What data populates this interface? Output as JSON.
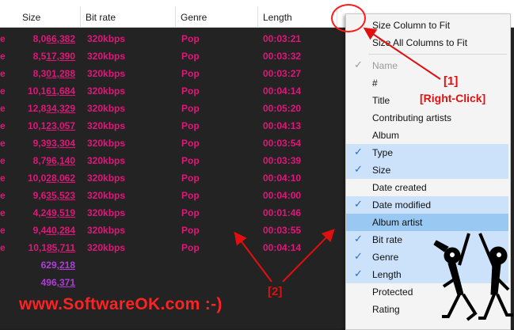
{
  "header": {
    "columns": [
      {
        "label": "Size"
      },
      {
        "label": "Bit rate"
      },
      {
        "label": "Genre"
      },
      {
        "label": "Length"
      }
    ]
  },
  "rows": [
    {
      "prefix": "e",
      "size_a": "8,0",
      "size_b": "66,382",
      "bitrate": "320kbps",
      "genre": "Pop",
      "length": "00:03:21"
    },
    {
      "prefix": "e",
      "size_a": "8,5",
      "size_b": "17,390",
      "bitrate": "320kbps",
      "genre": "Pop",
      "length": "00:03:32"
    },
    {
      "prefix": "e",
      "size_a": "8,3",
      "size_b": "01,288",
      "bitrate": "320kbps",
      "genre": "Pop",
      "length": "00:03:27"
    },
    {
      "prefix": "e",
      "size_a": "10,1",
      "size_b": "61,684",
      "bitrate": "320kbps",
      "genre": "Pop",
      "length": "00:04:14"
    },
    {
      "prefix": "e",
      "size_a": "12,8",
      "size_b": "34,329",
      "bitrate": "320kbps",
      "genre": "Pop",
      "length": "00:05:20"
    },
    {
      "prefix": "e",
      "size_a": "10,1",
      "size_b": "23,057",
      "bitrate": "320kbps",
      "genre": "Pop",
      "length": "00:04:13"
    },
    {
      "prefix": "e",
      "size_a": "9,3",
      "size_b": "93,304",
      "bitrate": "320kbps",
      "genre": "Pop",
      "length": "00:03:54"
    },
    {
      "prefix": "e",
      "size_a": "8,7",
      "size_b": "96,140",
      "bitrate": "320kbps",
      "genre": "Pop",
      "length": "00:03:39"
    },
    {
      "prefix": "e",
      "size_a": "10,0",
      "size_b": "28,062",
      "bitrate": "320kbps",
      "genre": "Pop",
      "length": "00:04:10"
    },
    {
      "prefix": "e",
      "size_a": "9,6",
      "size_b": "35,523",
      "bitrate": "320kbps",
      "genre": "Pop",
      "length": "00:04:00"
    },
    {
      "prefix": "e",
      "size_a": "4,2",
      "size_b": "49,519",
      "bitrate": "320kbps",
      "genre": "Pop",
      "length": "00:01:46"
    },
    {
      "prefix": "e",
      "size_a": "9,4",
      "size_b": "40,284",
      "bitrate": "320kbps",
      "genre": "Pop",
      "length": "00:03:55"
    },
    {
      "prefix": "e",
      "size_a": "10,1",
      "size_b": "85,711",
      "bitrate": "320kbps",
      "genre": "Pop",
      "length": "00:04:14"
    },
    {
      "prefix": "",
      "size_a": "629,",
      "size_b": "218",
      "bitrate": "",
      "genre": "",
      "length": "",
      "purple": true
    },
    {
      "prefix": "",
      "size_a": "496,",
      "size_b": "371",
      "bitrate": "",
      "genre": "",
      "length": "",
      "purple": true
    }
  ],
  "menu": {
    "top_items": [
      {
        "label": "Size Column to Fit"
      },
      {
        "label": "Size All Columns to Fit"
      }
    ],
    "items": [
      {
        "label": "Name",
        "checked": true,
        "dim": true
      },
      {
        "label": "#",
        "checked": false
      },
      {
        "label": "Title",
        "checked": false
      },
      {
        "label": "Contributing artists",
        "checked": false
      },
      {
        "label": "Album",
        "checked": false
      },
      {
        "label": "Type",
        "checked": true
      },
      {
        "label": "Size",
        "checked": true
      },
      {
        "label": "Date created",
        "checked": false
      },
      {
        "label": "Date modified",
        "checked": true
      },
      {
        "label": "Album artist",
        "checked": false,
        "highlight": true
      },
      {
        "label": "Bit rate",
        "checked": true
      },
      {
        "label": "Genre",
        "checked": true
      },
      {
        "label": "Length",
        "checked": true
      },
      {
        "label": "Protected",
        "checked": false
      },
      {
        "label": "Rating",
        "checked": false
      }
    ],
    "check_glyph": "✓"
  },
  "annotations": {
    "label1": "[1]",
    "label1_sub": "[Right-Click]",
    "label2": "[2]",
    "brand": "www.SoftwareOK.com :-)"
  },
  "colors": {
    "accent_text": "#e0177a",
    "purple_text": "#b03dd9",
    "annotation_red": "#e01010"
  }
}
